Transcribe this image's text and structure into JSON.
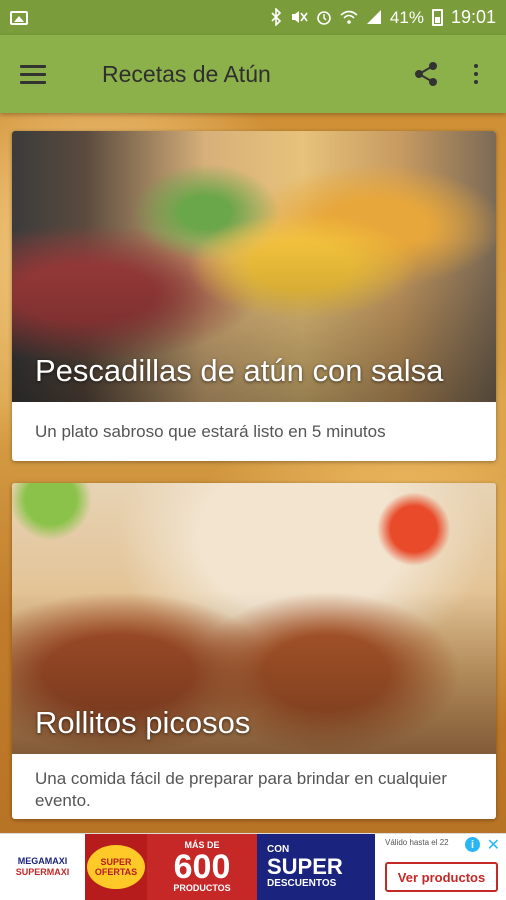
{
  "status_bar": {
    "battery_percent": "41%",
    "time": "19:01",
    "icons": [
      "image-icon",
      "bluetooth-icon",
      "mute-icon",
      "alarm-icon",
      "wifi-icon",
      "signal-icon",
      "battery-icon"
    ]
  },
  "app_bar": {
    "title": "Recetas de Atún",
    "menu_icon": "hamburger-menu-icon",
    "share_icon": "share-icon",
    "more_icon": "more-vertical-icon"
  },
  "cards": [
    {
      "title": "Pescadillas de atún con salsa",
      "description": "Un plato sabroso que estará listo en 5 minutos"
    },
    {
      "title": "Rollitos picosos",
      "description": "Una comida fácil de preparar para brindar en cualquier evento."
    }
  ],
  "ad": {
    "logo_top": "MEGAMAXI",
    "logo_bottom": "SUPERMAXI",
    "badge_top": "SUPER",
    "badge_bottom": "OFERTAS",
    "count_prefix": "MÁS DE",
    "count": "600",
    "count_suffix": "PRODUCTOS",
    "super_line1": "CON",
    "super_line2": "SUPER",
    "super_line3": "DESCUENTOS",
    "valid_text": "Válido hasta el 22",
    "cta_label": "Ver productos",
    "info_icon": "i",
    "close_icon": "✕"
  },
  "colors": {
    "status_bar": "#7a9c3a",
    "app_bar": "#8cb04a",
    "ad_red": "#c62828",
    "ad_blue": "#1a237e"
  }
}
